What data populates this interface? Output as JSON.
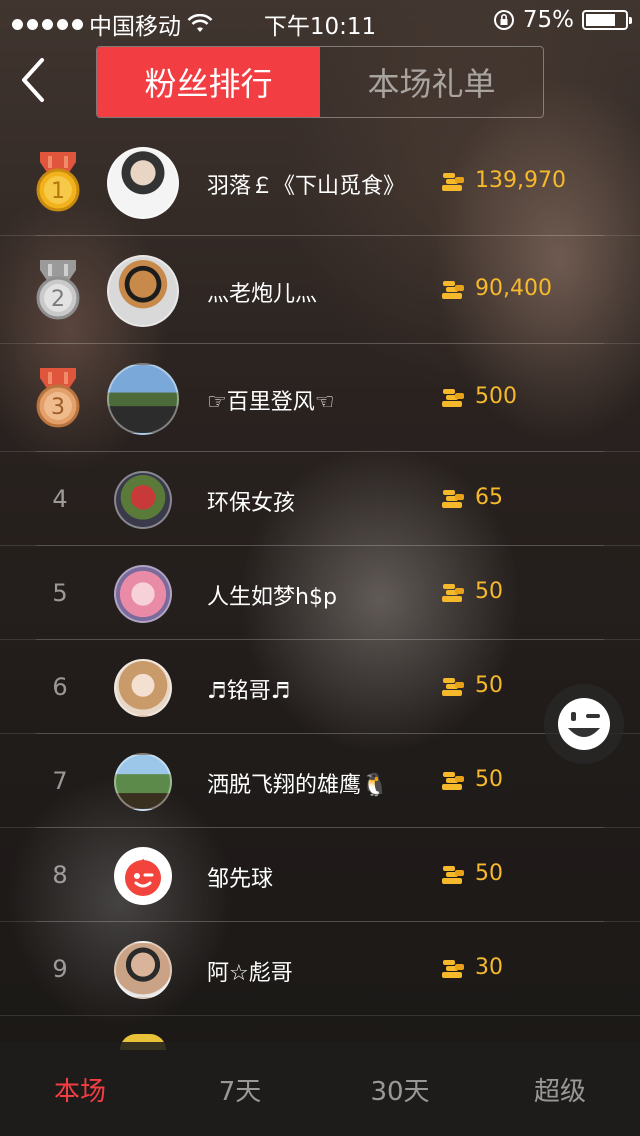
{
  "status_bar": {
    "carrier": "中国移动",
    "time": "下午10:11",
    "battery_percent": "75%",
    "battery_level": 0.75
  },
  "header": {
    "tabs": [
      {
        "label": "粉丝排行",
        "active": true
      },
      {
        "label": "本场礼单",
        "active": false
      }
    ]
  },
  "ranking": [
    {
      "rank": "1",
      "medal": "gold",
      "name": "羽落￡《下山觅食》",
      "score": "139,970",
      "avatar_icon": "avatar-photo"
    },
    {
      "rank": "2",
      "medal": "silver",
      "name": "灬老炮儿灬",
      "score": "90,400",
      "avatar_icon": "avatar-photo"
    },
    {
      "rank": "3",
      "medal": "bronze",
      "name": "☞百里登风☜",
      "score": "500",
      "avatar_icon": "avatar-photo"
    },
    {
      "rank": "4",
      "name": "环保女孩",
      "score": "65",
      "avatar_icon": "avatar-photo"
    },
    {
      "rank": "5",
      "name": "人生如梦h$p",
      "score": "50",
      "avatar_icon": "avatar-photo"
    },
    {
      "rank": "6",
      "name": "♬铭哥♬",
      "score": "50",
      "avatar_icon": "avatar-photo"
    },
    {
      "rank": "7",
      "name": "洒脱飞翔的雄鹰🐧",
      "score": "50",
      "avatar_icon": "avatar-photo"
    },
    {
      "rank": "8",
      "name": "邹先球",
      "score": "50",
      "avatar_icon": "default-avatar-icon"
    },
    {
      "rank": "9",
      "name": "阿☆彪哥",
      "score": "30",
      "avatar_icon": "avatar-photo"
    }
  ],
  "bottom_tabs": [
    {
      "label": "本场",
      "active": true
    },
    {
      "label": "7天",
      "active": false
    },
    {
      "label": "30天",
      "active": false
    },
    {
      "label": "超级",
      "active": false
    }
  ],
  "colors": {
    "accent": "#f23d43",
    "score": "#f7b92c",
    "gold": "#f2b21c",
    "silver": "#c9c9c9",
    "bronze": "#e4a06a"
  },
  "icons": {
    "back": "chevron-left-icon",
    "coin": "coin-stack-icon",
    "fab": "wink-face-icon",
    "signal": "signal-dots-icon",
    "wifi": "wifi-icon",
    "lock": "rotation-lock-icon",
    "battery": "battery-icon"
  }
}
